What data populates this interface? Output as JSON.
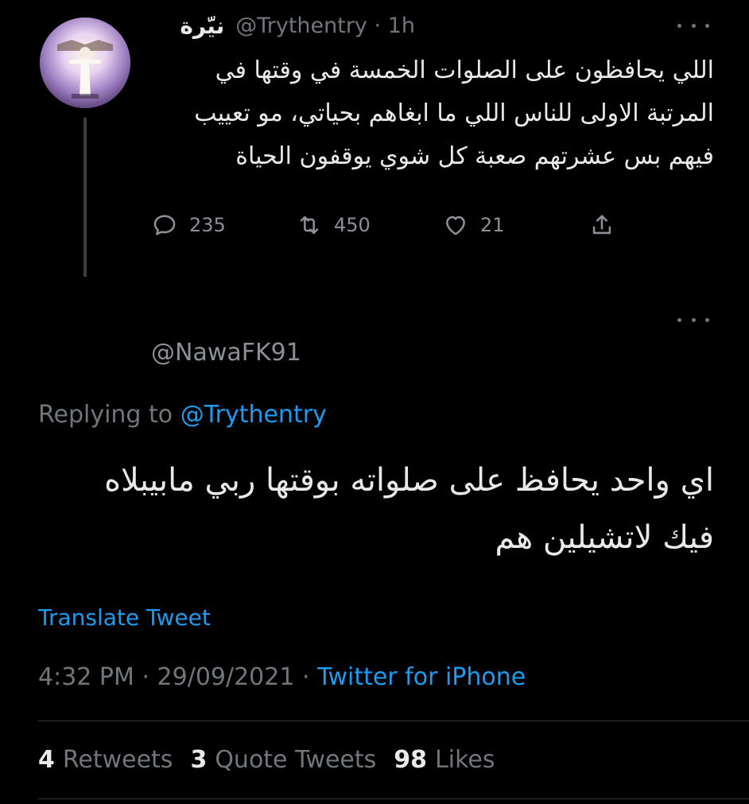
{
  "parent_tweet": {
    "display_name": "نيّرة",
    "handle": "@Trythentry",
    "separator": "·",
    "time": "1h",
    "text": "اللي يحافظون على الصلوات الخمسة في وقتها في المرتبة الاولى للناس اللي ما ابغاهم بحياتي، مو تعييب فيهم بس عشرتهم صعبة كل شوي يوقفون الحياة",
    "reply_count": "235",
    "retweet_count": "450",
    "like_count": "21"
  },
  "reply_tweet": {
    "handle": "@NawaFK91",
    "replying_prefix": "Replying to",
    "replying_to": "@Trythentry",
    "text": "اي واحد يحافظ على صلواته بوقتها ربي مابيبلاه فيك لاتشيلين هم",
    "translate_label": "Translate Tweet",
    "time": "4:32 PM",
    "separator": "·",
    "date": "29/09/2021",
    "source": "Twitter for iPhone"
  },
  "stats": {
    "retweets_count": "4",
    "retweets_label": "Retweets",
    "quote_count": "3",
    "quote_label": "Quote Tweets",
    "likes_count": "98",
    "likes_label": "Likes"
  },
  "icons": {
    "reply": "comment-icon",
    "retweet": "retweet-icon",
    "like": "heart-icon",
    "share": "share-icon",
    "more": "more-dots-icon"
  },
  "colors": {
    "background": "#000000",
    "text": "#e7e9ea",
    "secondary": "#71767b",
    "accent": "#1d9bf0"
  }
}
